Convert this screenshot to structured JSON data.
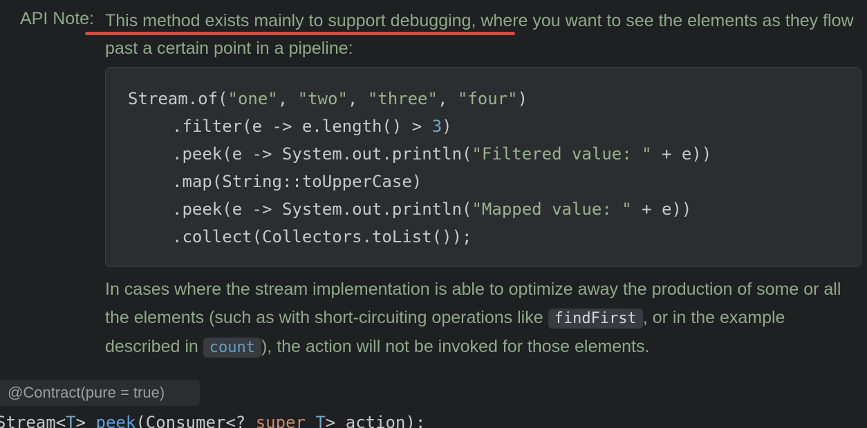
{
  "api_note": {
    "label": "API Note:",
    "underlined_text": "This method exists mainly to support debugging,",
    "rest_text": " where you want to see the elements as they flow past a certain point in a pipeline:"
  },
  "code_example": {
    "line1": {
      "prefix": "Stream.of(",
      "s1": "\"one\"",
      "sep1": ", ",
      "s2": "\"two\"",
      "sep2": ", ",
      "s3": "\"three\"",
      "sep3": ", ",
      "s4": "\"four\"",
      "suffix": ")"
    },
    "line2": {
      "prefix": ".filter(e -> e.length() > ",
      "num": "3",
      "suffix": ")"
    },
    "line3": {
      "prefix": ".peek(e -> System.out.println(",
      "str": "\"Filtered value: \"",
      "suffix": " + e))"
    },
    "line4": ".map(String::toUpperCase)",
    "line5": {
      "prefix": ".peek(e -> System.out.println(",
      "str": "\"Mapped value: \"",
      "suffix": " + e))"
    },
    "line6": ".collect(Collectors.toList());"
  },
  "description": {
    "part1": "In cases where the stream implementation is able to optimize away the production of some or all the elements (such as with short-circuiting operations like ",
    "code1": "findFirst",
    "part2": ", or in the example described in ",
    "code2": "count",
    "part3": "), the action will not be invoked for those elements."
  },
  "annotation": "@Contract(pure = true)",
  "signature": {
    "type_name": "Stream",
    "lt1": "<",
    "type_param": "T",
    "gt1": ">",
    "space": " ",
    "method": "peek",
    "open": "(Consumer<? ",
    "keyword": "super",
    "space2": " ",
    "type_param2": "T",
    "close": "> action);"
  },
  "colors": {
    "background": "#1f2022",
    "doc_text": "#8fa88a",
    "code_block_bg": "#2b2d30",
    "underline": "#e0463a",
    "link": "#5fa2c8",
    "keyword": "#cf8e6d"
  }
}
